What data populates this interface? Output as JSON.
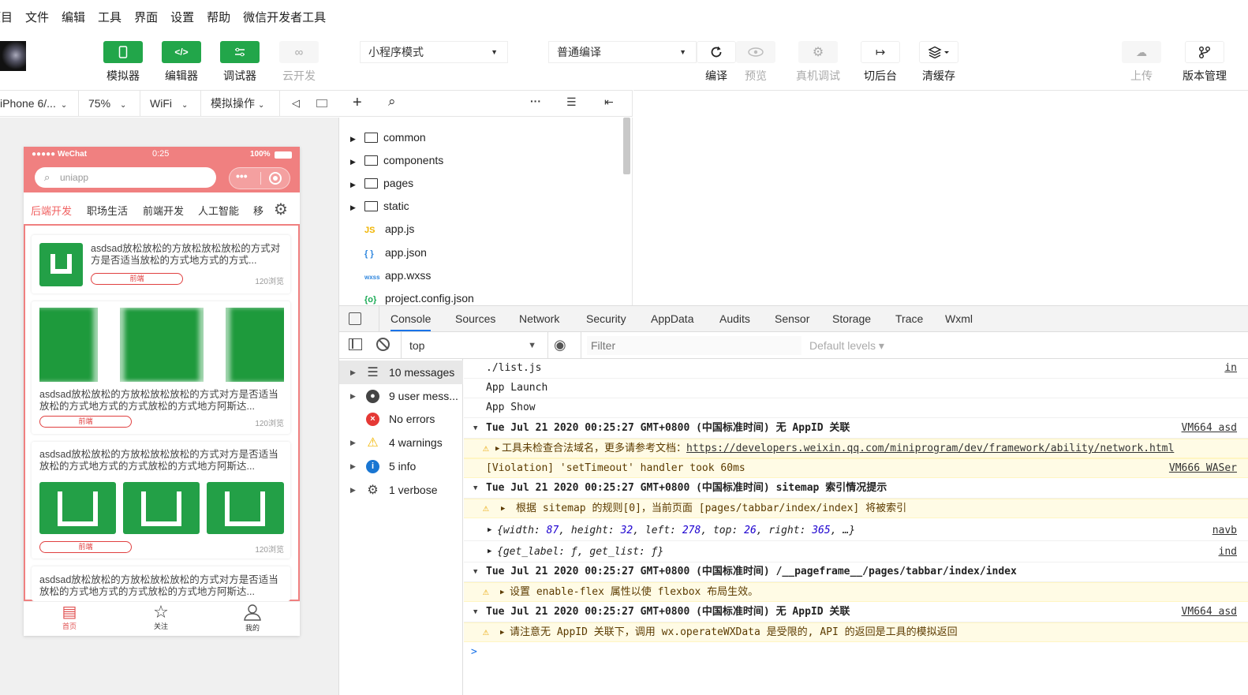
{
  "menu": [
    "项目",
    "文件",
    "编辑",
    "工具",
    "界面",
    "设置",
    "帮助",
    "微信开发者工具"
  ],
  "toolbar": {
    "simulator": "模拟器",
    "editor": "编辑器",
    "debugger": "调试器",
    "cloud": "云开发",
    "mode_select": "小程序模式",
    "compile_select": "普通编译",
    "compile": "编译",
    "preview": "预览",
    "remote_debug": "真机调试",
    "background": "切后台",
    "clear_cache": "清缓存",
    "upload": "上传",
    "version": "版本管理"
  },
  "simbar": {
    "device": "iPhone 6/...",
    "zoom": "75%",
    "network": "WiFi",
    "operation": "模拟操作"
  },
  "phone": {
    "status_left": "●●●●● WeChat",
    "status_time": "0:25",
    "status_battery": "100%",
    "search_placeholder": "uniapp",
    "tabs": [
      "后端开发",
      "职场生活",
      "前端开发",
      "人工智能",
      "移"
    ],
    "cards": [
      {
        "title": "asdsad放松放松的方放松放松放松的方式对方是否适当放松的方式地方式的方式...",
        "tag": "前端",
        "views": "120浏览"
      },
      {
        "title": "asdsad放松放松的方放松放松放松的方式对方是否适当放松的方式地方式的方式放松的方式地方阿斯达...",
        "tag": "前端",
        "views": "120浏览"
      },
      {
        "title": "asdsad放松放松的方放松放松放松的方式对方是否适当放松的方式地方式的方式放松的方式地方阿斯达...",
        "tag": "前端",
        "views": "120浏览"
      },
      {
        "title": "asdsad放松放松的方放松放松放松的方式对方是否适当放松的方式地方式的方式放松的方式地方阿斯达..."
      }
    ],
    "bottom_tabs": [
      "首页",
      "关注",
      "我的"
    ]
  },
  "files": [
    {
      "name": "common",
      "type": "folder"
    },
    {
      "name": "components",
      "type": "folder"
    },
    {
      "name": "pages",
      "type": "folder"
    },
    {
      "name": "static",
      "type": "folder"
    },
    {
      "name": "app.js",
      "type": "js",
      "icon": "JS"
    },
    {
      "name": "app.json",
      "type": "json",
      "icon": "{ }"
    },
    {
      "name": "app.wxss",
      "type": "wxss",
      "icon": "wxss"
    },
    {
      "name": "project.config.json",
      "type": "config",
      "icon": "{o}"
    }
  ],
  "devtools": {
    "tabs": [
      "Console",
      "Sources",
      "Network",
      "Security",
      "AppData",
      "Audits",
      "Sensor",
      "Storage",
      "Trace",
      "Wxml"
    ],
    "active_tab": "Console",
    "context": "top",
    "filter_placeholder": "Filter",
    "levels": "Default levels"
  },
  "console_sidebar": [
    {
      "label": "10 messages",
      "icon": "list-icon"
    },
    {
      "label": "9 user mess...",
      "icon": "user-icon"
    },
    {
      "label": "No errors",
      "icon": "error-icon"
    },
    {
      "label": "4 warnings",
      "icon": "warning-icon"
    },
    {
      "label": "5 info",
      "icon": "info-icon"
    },
    {
      "label": "1 verbose",
      "icon": "bug-icon"
    }
  ],
  "console_lines": {
    "l1": "./list.js",
    "l1_src": "in",
    "l2": "App Launch",
    "l3": "App Show",
    "g1": "Tue Jul 21 2020 00:25:27 GMT+0800 (中国标准时间) 无 AppID 关联",
    "g1_src": "VM664 asd",
    "w1_text": "工具未检查合法域名，更多请参考文档：",
    "w1_link": "https://developers.weixin.qq.com/miniprogram/dev/framework/ability/network.html",
    "w2": "[Violation] 'setTimeout' handler took 60ms",
    "w2_src": "VM666 WASer",
    "g2": "Tue Jul 21 2020 00:25:27 GMT+0800 (中国标准时间) sitemap 索引情况提示",
    "w3": "根据 sitemap 的规则[0]，当前页面 [pages/tabbar/index/index] 将被索引",
    "o1_width": "87",
    "o1_height": "32",
    "o1_left": "278",
    "o1_top": "26",
    "o1_right": "365",
    "o1_src": "navb",
    "o2": "{get_label: ƒ, get_list: ƒ}",
    "o2_src": "ind",
    "g3": "Tue Jul 21 2020 00:25:27 GMT+0800 (中国标准时间) /__pageframe__/pages/tabbar/index/index",
    "w4": "设置 enable-flex 属性以使 flexbox 布局生效。",
    "g4": "Tue Jul 21 2020 00:25:27 GMT+0800 (中国标准时间) 无 AppID 关联",
    "g4_src": "VM664 asd",
    "w5": "请注意无 AppID 关联下，调用 wx.operateWXData 是受限的, API 的返回是工具的模拟返回",
    "prompt": ">"
  },
  "colors": {
    "green": "#22a64a",
    "phone_red": "#f08080",
    "link_blue": "#1a73e8"
  }
}
